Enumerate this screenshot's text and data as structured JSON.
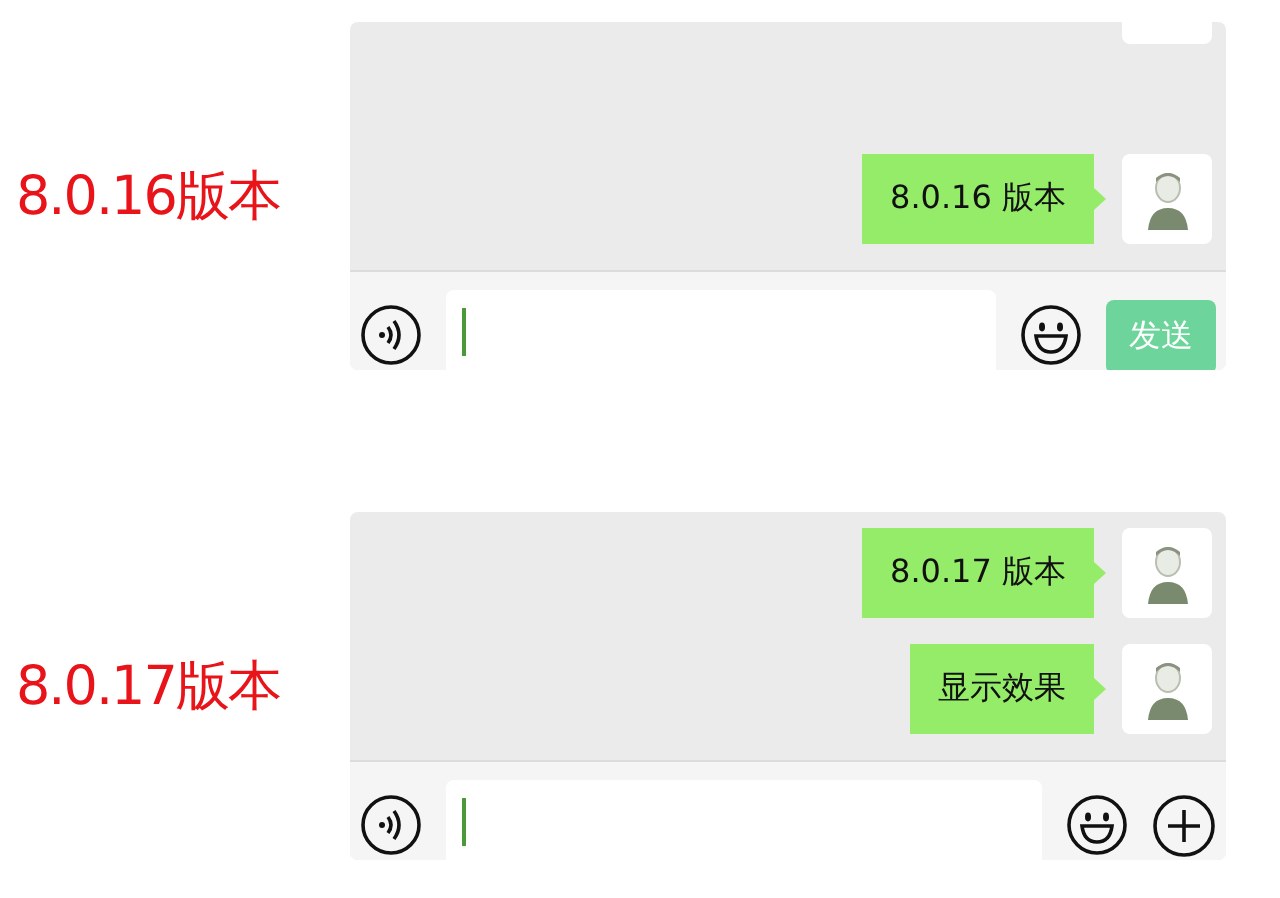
{
  "panels": [
    {
      "label": "8.0.16版本",
      "top_cut_avatar": true,
      "messages": [
        {
          "text": "8.0.16 版本"
        }
      ],
      "action": {
        "kind": "send",
        "text": "发送"
      }
    },
    {
      "label": "8.0.17版本",
      "top_cut_avatar": false,
      "messages": [
        {
          "text": "8.0.17 版本"
        },
        {
          "text": "显示效果"
        }
      ],
      "action": {
        "kind": "plus"
      }
    }
  ]
}
